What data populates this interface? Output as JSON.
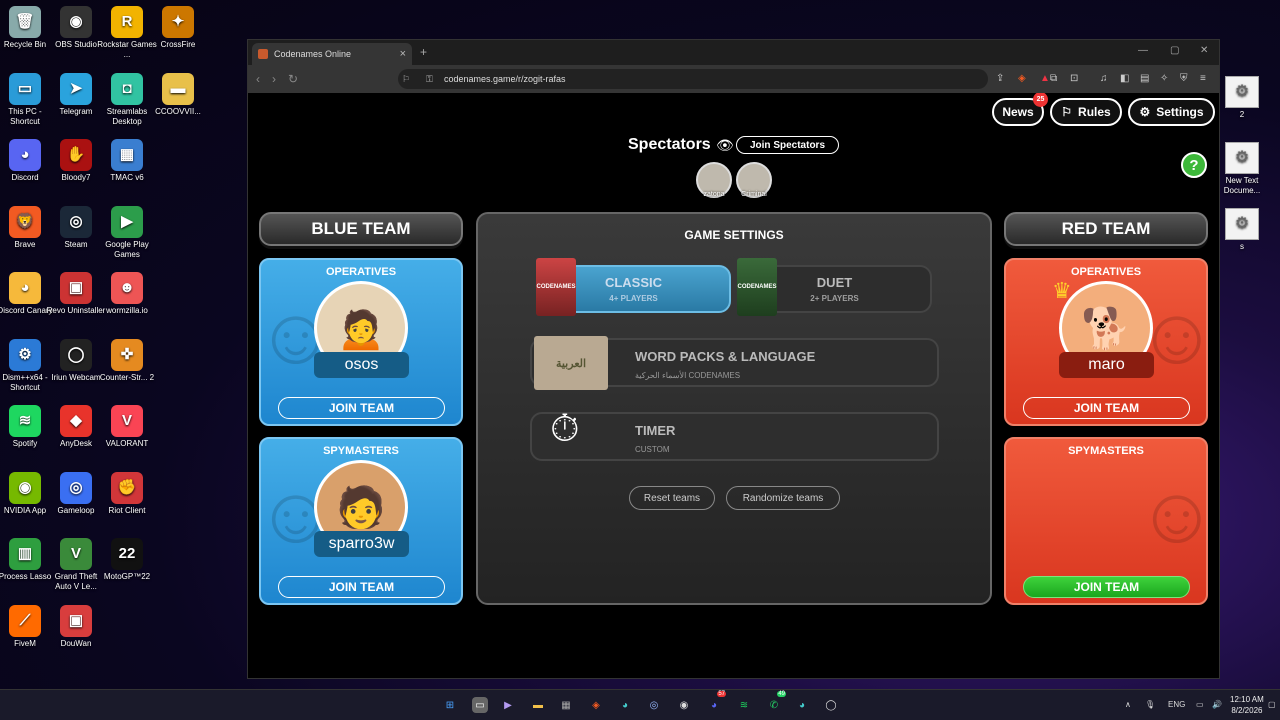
{
  "desktop_left": [
    {
      "label": "Recycle Bin",
      "icon": "recycle-bin-icon",
      "glyph": "🗑",
      "color": "#8aa"
    },
    {
      "label": "OBS Studio",
      "icon": "obs-icon",
      "glyph": "◉",
      "color": "#333"
    },
    {
      "label": "Rockstar Games ...",
      "icon": "rockstar-icon",
      "glyph": "R",
      "color": "#f2b300"
    },
    {
      "label": "CrossFire",
      "icon": "crossfire-icon",
      "glyph": "✦",
      "color": "#c70"
    },
    {
      "label": "This PC - Shortcut",
      "icon": "this-pc-icon",
      "glyph": "▭",
      "color": "#2a9bd8"
    },
    {
      "label": "Telegram",
      "icon": "telegram-icon",
      "glyph": "➤",
      "color": "#2aa3dd"
    },
    {
      "label": "Streamlabs Desktop",
      "icon": "streamlabs-icon",
      "glyph": "◘",
      "color": "#31c3a2"
    },
    {
      "label": "CCOOVVII...",
      "icon": "folder-icon",
      "glyph": "▬",
      "color": "#e8c04a"
    },
    {
      "label": "Discord",
      "icon": "discord-icon",
      "glyph": "◕",
      "color": "#5865f2"
    },
    {
      "label": "Bloody7",
      "icon": "bloody7-icon",
      "glyph": "✋",
      "color": "#a11"
    },
    {
      "label": "TMAC v6",
      "icon": "tmac-icon",
      "glyph": "▦",
      "color": "#3a7ed0"
    },
    {
      "label": "Brave",
      "icon": "brave-icon",
      "glyph": "🦁",
      "color": "#f25a22"
    },
    {
      "label": "Steam",
      "icon": "steam-icon",
      "glyph": "◎",
      "color": "#1b2838"
    },
    {
      "label": "Google Play Games",
      "icon": "google-play-games-icon",
      "glyph": "▶",
      "color": "#2c9d4b"
    },
    {
      "label": "Discord Canary",
      "icon": "discord-canary-icon",
      "glyph": "◕",
      "color": "#f6b93b"
    },
    {
      "label": "Revo Uninstaller",
      "icon": "revo-icon",
      "glyph": "▣",
      "color": "#c33"
    },
    {
      "label": "wormzilla.io",
      "icon": "wormzilla-icon",
      "glyph": "☻",
      "color": "#e55"
    },
    {
      "label": "Dism++x64 - Shortcut",
      "icon": "dism-icon",
      "glyph": "⚙",
      "color": "#2b7ad6"
    },
    {
      "label": "Iriun Webcam",
      "icon": "iriun-icon",
      "glyph": "◯",
      "color": "#222"
    },
    {
      "label": "Counter-Str... 2",
      "icon": "cs2-icon",
      "glyph": "✜",
      "color": "#e58a20"
    },
    {
      "label": "Spotify",
      "icon": "spotify-icon",
      "glyph": "≋",
      "color": "#1ed760"
    },
    {
      "label": "AnyDesk",
      "icon": "anydesk-icon",
      "glyph": "◆",
      "color": "#e8332b"
    },
    {
      "label": "VALORANT",
      "icon": "valorant-icon",
      "glyph": "V",
      "color": "#fa4454"
    },
    {
      "label": "NVIDIA App",
      "icon": "nvidia-icon",
      "glyph": "◉",
      "color": "#76b900"
    },
    {
      "label": "Gameloop",
      "icon": "gameloop-icon",
      "glyph": "◎",
      "color": "#3a6ff2"
    },
    {
      "label": "Riot Client",
      "icon": "riot-icon",
      "glyph": "✊",
      "color": "#d13639"
    },
    {
      "label": "Process Lasso",
      "icon": "process-lasso-icon",
      "glyph": "▥",
      "color": "#2e9e3f"
    },
    {
      "label": "Grand Theft Auto V Le...",
      "icon": "gta-icon",
      "glyph": "V",
      "color": "#3a8a3a"
    },
    {
      "label": "MotoGP™22",
      "icon": "motogp-icon",
      "glyph": "22",
      "color": "#111"
    },
    {
      "label": "FiveM",
      "icon": "fivem-icon",
      "glyph": "⟋",
      "color": "#ff6a00"
    },
    {
      "label": "DouWan",
      "icon": "douwan-icon",
      "glyph": "▣",
      "color": "#d83d3d"
    }
  ],
  "desktop_right": [
    {
      "label": "2",
      "icon": "settings-file-icon"
    },
    {
      "label": "New Text Docume...",
      "icon": "text-file-icon"
    },
    {
      "label": "s",
      "icon": "settings-file-icon"
    }
  ],
  "browser": {
    "tab_title": "Codenames Online",
    "url": "codenames.game/r/zogit-rafas"
  },
  "topbar": {
    "news_label": "News",
    "news_badge": "25",
    "rules_label": "Rules",
    "settings_label": "Settings"
  },
  "help_label": "?",
  "spectators": {
    "title": "Spectators",
    "join_label": "Join Spectators",
    "players": [
      "zatona",
      "Criminal"
    ]
  },
  "blue_team": {
    "title": "BLUE TEAM",
    "operatives_title": "OPERATIVES",
    "operative_player": "osos",
    "operatives_join": "JOIN TEAM",
    "spymasters_title": "SPYMASTERS",
    "spymaster_player": "sparro3w",
    "spymasters_join": "JOIN TEAM"
  },
  "red_team": {
    "title": "RED TEAM",
    "operatives_title": "OPERATIVES",
    "operative_player": "maro",
    "operatives_join": "JOIN TEAM",
    "spymasters_title": "SPYMASTERS",
    "spymasters_join": "JOIN TEAM"
  },
  "game_settings": {
    "title": "GAME SETTINGS",
    "modes": [
      {
        "name": "CLASSIC",
        "sub": "4+ PLAYERS",
        "box_label": "CODENAMES",
        "active": true
      },
      {
        "name": "DUET",
        "sub": "2+ PLAYERS",
        "box_label": "CODENAMES",
        "active": false
      }
    ],
    "word_packs": {
      "name": "WORD PACKS & LANGUAGE",
      "sub": "الأسماء الحركية CODENAMES",
      "box_label": "العربية"
    },
    "timer": {
      "name": "TIMER",
      "sub": "CUSTOM"
    },
    "reset_label": "Reset teams",
    "randomize_label": "Randomize teams"
  },
  "taskbar": {
    "tray_lang": "ENG",
    "time": "12:10 AM",
    "date": "8/2/2026",
    "discord_badge": "57",
    "whatsapp_badge": "49"
  }
}
